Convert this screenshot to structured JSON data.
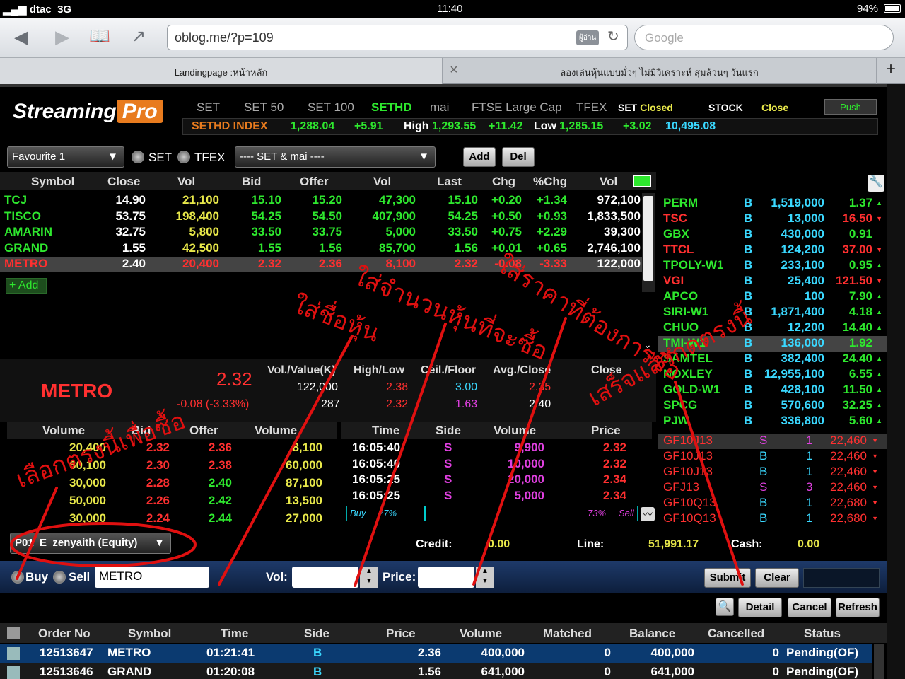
{
  "status": {
    "carrier": "dtac",
    "network": "3G",
    "time": "11:40",
    "battery": "94%"
  },
  "browser": {
    "url": "oblog.me/?p=109",
    "reader": "ผู้อ่าน",
    "search_placeholder": "Google",
    "tabs": [
      "Landingpage :หน้าหลัก",
      "ลองเล่นหุ้นแบบมั่วๆ ไม่มีวิเคราะห์ สุ่มล้วนๆ วันแรก"
    ]
  },
  "app": {
    "logo_a": "Streaming",
    "logo_b": "Pro",
    "markets": [
      "SET",
      "SET 50",
      "SET 100",
      "SETHD",
      "mai",
      "FTSE Large Cap",
      "TFEX"
    ],
    "set_status_label": "SET",
    "set_status": "Closed",
    "stock_label": "STOCK",
    "stock_status": "Close",
    "push": "Push",
    "index": {
      "name": "SETHD INDEX",
      "value": "1,288.04",
      "chg": "+5.91",
      "high_label": "High",
      "high": "1,293.55",
      "high_chg": "+11.42",
      "low_label": "Low",
      "low": "1,285.15",
      "low_chg": "+3.02",
      "vol": "10,495.08"
    },
    "favourite": "Favourite 1",
    "radio_set": "SET",
    "radio_tfex": "TFEX",
    "market_sel": "---- SET & mai ----",
    "add": "Add",
    "del": "Del",
    "cols": [
      "Symbol",
      "Close",
      "Vol",
      "Bid",
      "Offer",
      "Vol",
      "Last",
      "Chg",
      "%Chg",
      "Vol"
    ],
    "rows": [
      [
        "TCJ",
        "14.90",
        "21,100",
        "15.10",
        "15.20",
        "47,300",
        "15.10",
        "+0.20",
        "+1.34",
        "972,100"
      ],
      [
        "TISCO",
        "53.75",
        "198,400",
        "54.25",
        "54.50",
        "407,900",
        "54.25",
        "+0.50",
        "+0.93",
        "1,833,500"
      ],
      [
        "AMARIN",
        "32.75",
        "5,800",
        "33.50",
        "33.75",
        "5,000",
        "33.50",
        "+0.75",
        "+2.29",
        "39,300"
      ],
      [
        "GRAND",
        "1.55",
        "42,500",
        "1.55",
        "1.56",
        "85,700",
        "1.56",
        "+0.01",
        "+0.65",
        "2,746,100"
      ],
      [
        "METRO",
        "2.40",
        "20,400",
        "2.32",
        "2.36",
        "8,100",
        "2.32",
        "-0.08",
        "-3.33",
        "122,000"
      ]
    ],
    "add_row": "+ Add",
    "side_list": [
      [
        "PERM",
        "B",
        "1,519,000",
        "1.37",
        "up"
      ],
      [
        "TSC",
        "B",
        "13,000",
        "16.50",
        "down"
      ],
      [
        "GBX",
        "B",
        "430,000",
        "0.91",
        ""
      ],
      [
        "TTCL",
        "B",
        "124,200",
        "37.00",
        "down"
      ],
      [
        "TPOLY-W1",
        "B",
        "233,100",
        "0.95",
        "up"
      ],
      [
        "VGI",
        "B",
        "25,400",
        "121.50",
        "down"
      ],
      [
        "APCO",
        "B",
        "100",
        "7.90",
        "up"
      ],
      [
        "SIRI-W1",
        "B",
        "1,871,400",
        "4.18",
        "up"
      ],
      [
        "CHUO",
        "B",
        "12,200",
        "14.40",
        "up"
      ],
      [
        "TMI-W1",
        "B",
        "136,000",
        "1.92",
        ""
      ],
      [
        "SAMTEL",
        "B",
        "382,400",
        "24.40",
        "up"
      ],
      [
        "NOXLEY",
        "B",
        "12,955,100",
        "6.55",
        "up"
      ],
      [
        "GOLD-W1",
        "B",
        "428,100",
        "11.50",
        "up"
      ],
      [
        "SPCG",
        "B",
        "570,600",
        "32.25",
        "up"
      ],
      [
        "PJW",
        "B",
        "336,800",
        "5.60",
        "up"
      ]
    ],
    "tfex_list": [
      [
        "GF10J13",
        "S",
        "1",
        "22,460"
      ],
      [
        "GF10J13",
        "B",
        "1",
        "22,460"
      ],
      [
        "GF10J13",
        "B",
        "1",
        "22,460"
      ],
      [
        "GFJ13",
        "S",
        "3",
        "22,460"
      ],
      [
        "GF10Q13",
        "B",
        "1",
        "22,680"
      ],
      [
        "GF10Q13",
        "B",
        "1",
        "22,680"
      ]
    ],
    "detail": {
      "symbol": "METRO",
      "last": "2.32",
      "chg": "-0.08 (-3.33%)",
      "h1": "Vol./Value(K)",
      "h2": "High/Low",
      "h3": "Ceil./Floor",
      "h4": "Avg./Close",
      "h5": "Close",
      "vol": "122,000",
      "value": "287",
      "high": "2.38",
      "low": "2.32",
      "ceil": "3.00",
      "floor": "1.63",
      "avg": "2.35",
      "close": "2.40"
    },
    "book_cols": [
      "Volume",
      "Bid",
      "Offer",
      "Volume"
    ],
    "book": [
      [
        "20,400",
        "2.32",
        "2.36",
        "8,100"
      ],
      [
        "60,100",
        "2.30",
        "2.38",
        "60,000"
      ],
      [
        "30,000",
        "2.28",
        "2.40",
        "87,100"
      ],
      [
        "50,000",
        "2.26",
        "2.42",
        "13,500"
      ],
      [
        "30,000",
        "2.24",
        "2.44",
        "27,000"
      ]
    ],
    "ticks_cols": [
      "Time",
      "Side",
      "Volume",
      "Price"
    ],
    "ticks": [
      [
        "16:05:40",
        "S",
        "9,900",
        "2.32"
      ],
      [
        "16:05:40",
        "S",
        "10,000",
        "2.32"
      ],
      [
        "16:05:25",
        "S",
        "20,000",
        "2.34"
      ],
      [
        "16:05:25",
        "S",
        "5,000",
        "2.34"
      ]
    ],
    "buy_label": "Buy",
    "buy_pct": "27%",
    "sell_pct": "73%",
    "sell_label": "Sell",
    "buy_fraction": 0.27,
    "account": "P01_E_zenyaith (Equity)",
    "credit_label": "Credit:",
    "credit": "0.00",
    "line_label": "Line:",
    "line": "51,991.17",
    "cash_label": "Cash:",
    "cash": "0.00",
    "order": {
      "buy": "Buy",
      "sell": "Sell",
      "symbol": "METRO",
      "vol_label": "Vol:",
      "price_label": "Price:",
      "submit": "Submit",
      "clear": "Clear"
    },
    "detail_btn": "Detail",
    "cancel_btn": "Cancel",
    "refresh_btn": "Refresh",
    "order_cols": [
      "Order No",
      "Symbol",
      "Time",
      "Side",
      "Price",
      "Volume",
      "Matched",
      "Balance",
      "Cancelled",
      "Status"
    ],
    "orders": [
      [
        "12513647",
        "METRO",
        "01:21:41",
        "B",
        "2.36",
        "400,000",
        "0",
        "400,000",
        "0",
        "Pending(OF)"
      ],
      [
        "12513646",
        "GRAND",
        "01:20:08",
        "B",
        "1.56",
        "641,000",
        "0",
        "641,000",
        "0",
        "Pending(OF)"
      ]
    ]
  },
  "annotations": {
    "a1": "ใส่ชื่อหุ้น",
    "a2": "ใส่จำนวนหุ้นที่จะซื้อ",
    "a3": "ใส่ราคาที่ต้องการซื้อ",
    "a4": "เสร็จแล้วกดตรงนี้",
    "a5": "เลือกตรงนี้เพื่อซื้อ"
  },
  "colors": {
    "annotation": "#e01010",
    "up": "#2ee82e",
    "down": "#ff3030",
    "ceil": "#3ad8ff",
    "accent": "#e87b1e"
  }
}
